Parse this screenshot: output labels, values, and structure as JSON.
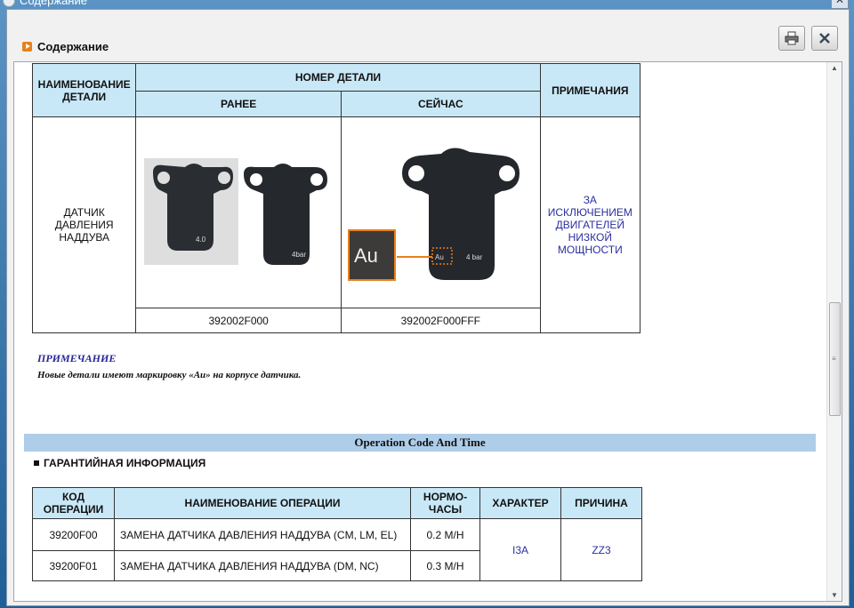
{
  "window": {
    "title": "Содержание",
    "close_glyph": "✕"
  },
  "header": {
    "title": "Содержание",
    "print_icon": "print-icon",
    "close_icon": "close-icon"
  },
  "parts_table": {
    "col_name": "НАИМЕНОВАНИЕ ДЕТАЛИ",
    "col_number": "НОМЕР ДЕТАЛИ",
    "col_before": "РАНЕЕ",
    "col_now": "СЕЙЧАС",
    "col_notes": "ПРИМЕЧАНИЯ",
    "row": {
      "name": "ДАТЧИК ДАВЛЕНИЯ НАДДУВА",
      "note": "ЗА ИСКЛЮЧЕНИЕМ ДВИГАТЕЛЕЙ НИЗКОЙ МОЩНОСТИ",
      "before_number": "392002F000",
      "now_number": "392002F000FFF",
      "au_label": "Au",
      "bar_label_old": "4.0",
      "bar_label_old2": "4bar",
      "bar_label_new": "4 bar"
    }
  },
  "note": {
    "title": "ПРИМЕЧАНИЕ",
    "text": "Новые детали имеют маркировку «Au» на корпусе датчика."
  },
  "operation_bar": "Operation Code And Time",
  "warranty_title": "ГАРАНТИЙНАЯ ИНФОРМАЦИЯ",
  "ops_table": {
    "headers": [
      "КОД ОПЕРАЦИИ",
      "НАИМЕНОВАНИЕ ОПЕРАЦИИ",
      "НОРМО-ЧАСЫ",
      "ХАРАКТЕР",
      "ПРИЧИНА"
    ],
    "rows": [
      {
        "code": "39200F00",
        "name": "ЗАМЕНА ДАТЧИКА ДАВЛЕНИЯ НАДДУВА (CM, LM, EL)",
        "hours": "0.2 M/H"
      },
      {
        "code": "39200F01",
        "name": "ЗАМЕНА ДАТЧИКА ДАВЛЕНИЯ НАДДУВА (DM, NC)",
        "hours": "0.3 M/H"
      }
    ],
    "nature": "I3A",
    "cause": "ZZ3"
  },
  "colors": {
    "header_bg": "#c9e8f7",
    "op_bar_bg": "#aecde9",
    "note_blue": "#2b2fa0",
    "au_orange": "#e8801a"
  }
}
